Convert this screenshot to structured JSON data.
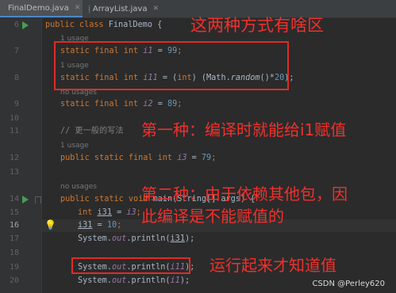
{
  "tabs": [
    {
      "label": "FinalDemo.java",
      "icon": "java-class-icon",
      "active": true
    },
    {
      "label": "ArrayList.java",
      "icon": "java-class-icon",
      "active": false
    }
  ],
  "gutter": {
    "line_numbers": [
      "6",
      "7",
      "8",
      "9",
      "10",
      "11",
      "12",
      "13",
      "14",
      "15",
      "16",
      "17",
      "18",
      "19",
      "20"
    ]
  },
  "code": {
    "class_decl": {
      "kw": "public class",
      "name": "FinalDemo",
      "brace": "{"
    },
    "hints": {
      "one_usage_1": "1 usage",
      "one_usage_2": "1 usage",
      "no_usages_1": "no usages",
      "one_usage_3": "1 usage",
      "no_usages_2": "no usages"
    },
    "line7": {
      "kw": "static final int",
      "field": "i1",
      "rest": " = ",
      "num": "99",
      "end": ";"
    },
    "line8": {
      "kw": "static final int",
      "field": "i11",
      "p1": " = (",
      "kw2": "int",
      "p2": ") (Math.",
      "method": "random",
      "p3": "()*",
      "num": "20",
      "p4": ");"
    },
    "line9": {
      "kw": "static final int",
      "field": "i2",
      "rest": " = ",
      "num": "89",
      "end": ";"
    },
    "line11": {
      "comment": "// 更一般的写法"
    },
    "line12": {
      "kw": "public static final int",
      "field": "i3",
      "rest": " = ",
      "num": "79",
      "end": ";"
    },
    "line14": {
      "kw": "public static void",
      "rest": " main(String[] args) {"
    },
    "line15": {
      "kw": "int",
      "var": "i31",
      "rest": " = ",
      "field": "i3",
      "end": ";"
    },
    "line16": {
      "var": "i31",
      "rest": " = ",
      "num": "10",
      "end": ";"
    },
    "line17": {
      "pre": "System.",
      "out": "out",
      "mid": ".println(",
      "var": "i31",
      "end": ");"
    },
    "line19": {
      "pre": "System.",
      "out": "out",
      "mid": ".println(",
      "field": "i11",
      "end": ");"
    },
    "line20": {
      "pre": "System.",
      "out": "out",
      "mid": ".println(",
      "field": "i1",
      "end": ");"
    }
  },
  "annotations": {
    "title": "这两种方式有啥区",
    "first": "第一种：编译时就能给i1赋值",
    "second_line1": "第二种：由于依赖其他包，因",
    "second_line2": "此编译是不能赋值的",
    "runtime": "运行起来才知道值"
  },
  "watermark": "CSDN @Perley620",
  "colors": {
    "annotation": "#f0312c",
    "keyword": "#cc7832",
    "field": "#9876aa",
    "number": "#6897bb"
  }
}
